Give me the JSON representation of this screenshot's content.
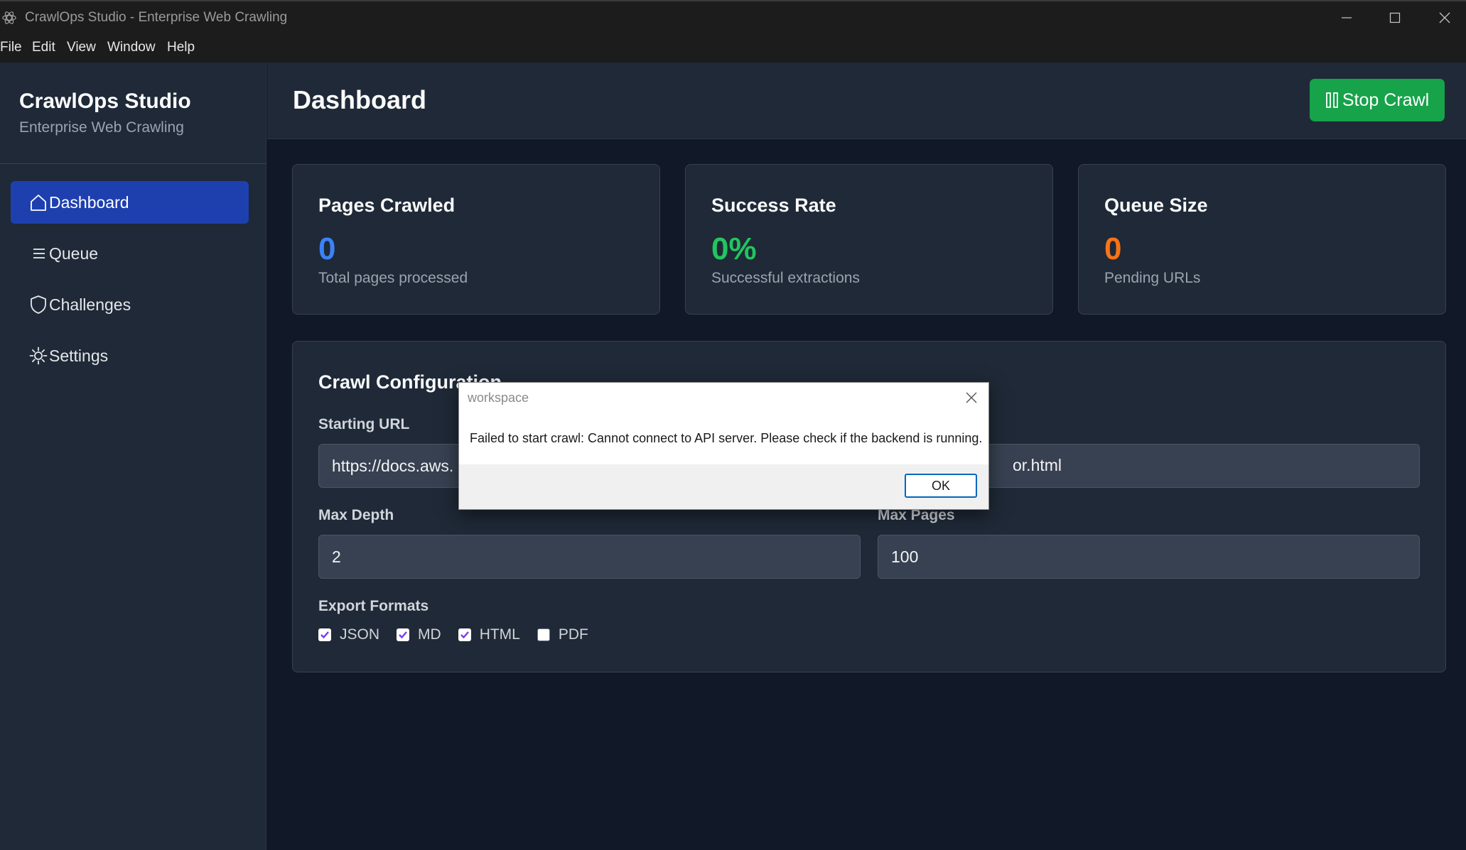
{
  "window": {
    "title": "CrawlOps Studio - Enterprise Web Crawling",
    "menu": [
      "File",
      "Edit",
      "View",
      "Window",
      "Help"
    ]
  },
  "sidebar": {
    "brand": "CrawlOps Studio",
    "subtitle": "Enterprise Web Crawling",
    "items": [
      {
        "label": "Dashboard",
        "icon": "home-icon",
        "active": true
      },
      {
        "label": "Queue",
        "icon": "list-icon",
        "active": false
      },
      {
        "label": "Challenges",
        "icon": "shield-icon",
        "active": false
      },
      {
        "label": "Settings",
        "icon": "gear-icon",
        "active": false
      }
    ]
  },
  "header": {
    "title": "Dashboard",
    "stop_label": "Stop Crawl"
  },
  "stats": [
    {
      "title": "Pages Crawled",
      "value": "0",
      "desc": "Total pages processed",
      "color": "#3b82f6"
    },
    {
      "title": "Success Rate",
      "value": "0%",
      "desc": "Successful extractions",
      "color": "#22c55e"
    },
    {
      "title": "Queue Size",
      "value": "0",
      "desc": "Pending URLs",
      "color": "#f97316"
    }
  ],
  "config": {
    "title": "Crawl Configuration",
    "starting_url_label": "Starting URL",
    "starting_url_visible_left": "https://docs.aws.",
    "starting_url_visible_right": "or.html",
    "max_depth_label": "Max Depth",
    "max_depth_value": "2",
    "max_pages_label": "Max Pages",
    "max_pages_value": "100",
    "export_label": "Export Formats",
    "formats": [
      {
        "label": "JSON",
        "checked": true
      },
      {
        "label": "MD",
        "checked": true
      },
      {
        "label": "HTML",
        "checked": true
      },
      {
        "label": "PDF",
        "checked": false
      }
    ]
  },
  "dialog": {
    "title": "workspace",
    "message": "Failed to start crawl: Cannot connect to API server. Please check if the backend is running.",
    "ok_label": "OK"
  },
  "colors": {
    "accent_blue": "#1e40af",
    "success_green": "#16a34a",
    "checkbox_purple": "#7c3aed"
  }
}
